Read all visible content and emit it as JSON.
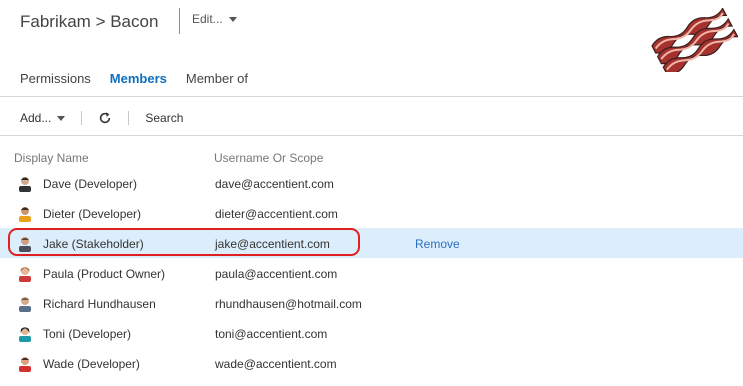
{
  "header": {
    "breadcrumb": "Fabrikam > Bacon",
    "edit_label": "Edit..."
  },
  "tabs": [
    {
      "label": "Permissions",
      "active": false
    },
    {
      "label": "Members",
      "active": true
    },
    {
      "label": "Member of",
      "active": false
    }
  ],
  "toolbar": {
    "add_label": "Add...",
    "search_label": "Search"
  },
  "table": {
    "columns": [
      "Display Name",
      "Username Or Scope"
    ],
    "rows": [
      {
        "name": "Dave (Developer)",
        "username": "dave@accentient.com",
        "selected": false,
        "action": ""
      },
      {
        "name": "Dieter (Developer)",
        "username": "dieter@accentient.com",
        "selected": false,
        "action": ""
      },
      {
        "name": "Jake (Stakeholder)",
        "username": "jake@accentient.com",
        "selected": true,
        "action": "Remove"
      },
      {
        "name": "Paula (Product Owner)",
        "username": "paula@accentient.com",
        "selected": false,
        "action": ""
      },
      {
        "name": "Richard Hundhausen",
        "username": "rhundhausen@hotmail.com",
        "selected": false,
        "action": ""
      },
      {
        "name": "Toni (Developer)",
        "username": "toni@accentient.com",
        "selected": false,
        "action": ""
      },
      {
        "name": "Wade (Developer)",
        "username": "wade@accentient.com",
        "selected": false,
        "action": ""
      }
    ]
  },
  "colors": {
    "accent": "#106ebe",
    "selected_row": "#dceefb",
    "highlight_outline": "#e02020",
    "link": "#2e6fbf"
  }
}
